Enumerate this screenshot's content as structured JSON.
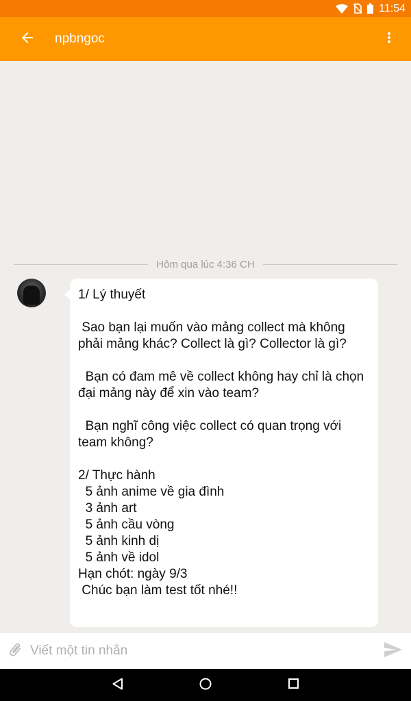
{
  "status_bar": {
    "time": "11:54",
    "icons": [
      "wifi-icon",
      "no-sim-icon",
      "battery-icon"
    ]
  },
  "app_bar": {
    "title": "npbngoc",
    "back_icon": "arrow-back-icon",
    "menu_icon": "more-vert-icon"
  },
  "chat": {
    "timestamp_divider": "Hôm qua lúc 4:36 CH",
    "messages": [
      {
        "sender": "npbngoc",
        "text": "1/ Lý thuyết\n\n Sao bạn lại muốn vào mảng collect mà không phải mảng khác? Collect là gì? Collector là gì?\n\n  Bạn có đam mê về collect không hay chỉ là chọn đại mảng này để xin vào team?\n\n  Bạn nghĩ công việc collect có quan trọng với team không?\n\n2/ Thực hành\n  5 ảnh anime về gia đình\n  3 ảnh art\n  5 ảnh cầu vòng\n  5 ảnh kinh dị\n  5 ảnh về idol\nHạn chót: ngày 9/3\n Chúc bạn làm test tốt nhé!!"
      }
    ]
  },
  "composer": {
    "placeholder": "Viết một tin nhắn",
    "value": ""
  },
  "nav_bar": {
    "icons": [
      "back-triangle-icon",
      "home-circle-icon",
      "recents-square-icon"
    ]
  },
  "colors": {
    "status_bar": "#f57c00",
    "app_bar": "#ff9800",
    "chat_background": "#efeeea",
    "bubble": "#ffffff"
  }
}
